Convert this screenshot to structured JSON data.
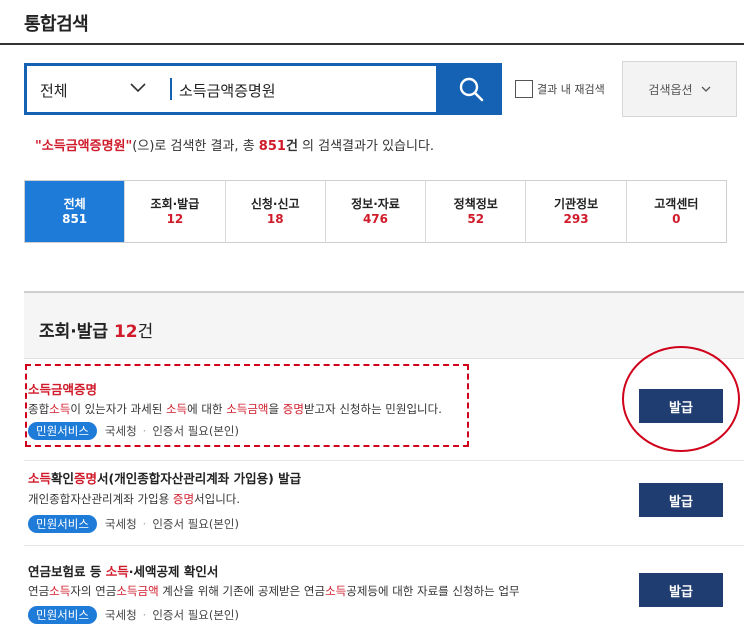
{
  "page": {
    "title": "통합검색"
  },
  "search": {
    "scope": "전체",
    "query": "소득금액증명원",
    "placeholder": "",
    "refine_label": "결과 내 재검색",
    "options_label": "검색옵션"
  },
  "summary": {
    "quote_open": "\"",
    "keyword": "소득금액증명원",
    "quote_close": "\"",
    "mid_text": "(으)로 검색한 결과, 총 ",
    "total": "851",
    "unit": "건",
    "tail_text": " 의 검색결과가 있습니다."
  },
  "tabs": [
    {
      "label": "전체",
      "count": "851",
      "active": true
    },
    {
      "label": "조회·발급",
      "count": "12"
    },
    {
      "label": "신청·신고",
      "count": "18"
    },
    {
      "label": "정보·자료",
      "count": "476"
    },
    {
      "label": "정책정보",
      "count": "52"
    },
    {
      "label": "기관정보",
      "count": "293"
    },
    {
      "label": "고객센터",
      "count": "0"
    }
  ],
  "section": {
    "title": "조회·발급",
    "count": "12",
    "unit": "건"
  },
  "results": [
    {
      "title": [
        {
          "t": "소득금액증명",
          "hl": true
        }
      ],
      "desc": [
        {
          "t": "종합"
        },
        {
          "t": "소득",
          "hl": true
        },
        {
          "t": "이 있는자가 과세된 "
        },
        {
          "t": "소득",
          "hl": true
        },
        {
          "t": "에 대한 "
        },
        {
          "t": "소득금액",
          "hl": true
        },
        {
          "t": "을 "
        },
        {
          "t": "증명",
          "hl": true
        },
        {
          "t": "받고자 신청하는 민원입니다."
        }
      ],
      "badge": "민원서비스",
      "agency": "국세청",
      "cert": "인증서 필요(본인)",
      "button": "발급"
    },
    {
      "title": [
        {
          "t": "소득",
          "hl": true
        },
        {
          "t": "확인"
        },
        {
          "t": "증명",
          "hl": true
        },
        {
          "t": "서(개인종합자산관리계좌 가입용) 발급"
        }
      ],
      "desc": [
        {
          "t": "개인종합자산관리계좌 가입용 "
        },
        {
          "t": "증명",
          "hl": true
        },
        {
          "t": "서입니다."
        }
      ],
      "badge": "민원서비스",
      "agency": "국세청",
      "cert": "인증서 필요(본인)",
      "button": "발급"
    },
    {
      "title": [
        {
          "t": "연금보험료 등 "
        },
        {
          "t": "소득",
          "hl": true
        },
        {
          "t": "·세액공제 확인서"
        }
      ],
      "desc": [
        {
          "t": "연금"
        },
        {
          "t": "소득",
          "hl": true
        },
        {
          "t": "자의 연금"
        },
        {
          "t": "소득금액",
          "hl": true
        },
        {
          "t": " 계산을 위해 기존에 공제받은 연금"
        },
        {
          "t": "소득",
          "hl": true
        },
        {
          "t": "공제등에 대한 자료를 신청하는 업무"
        }
      ],
      "badge": "민원서비스",
      "agency": "국세청",
      "cert": "인증서 필요(본인)",
      "button": "발급"
    }
  ],
  "colors": {
    "primary": "#1561b4",
    "tab_active": "#1f7bd8",
    "highlight": "#d01b2b",
    "button": "#1f3d70",
    "annotation": "#d0021b"
  },
  "icons": {
    "search": "search-icon",
    "chevron": "chevron-down-icon"
  }
}
